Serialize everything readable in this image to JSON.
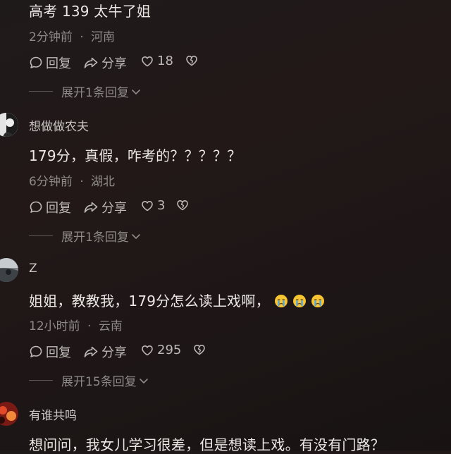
{
  "comments": [
    {
      "text": "高考 139 太牛了姐",
      "time": "2分钟前",
      "location": "河南",
      "reply_label": "回复",
      "share_label": "分享",
      "likes": "18",
      "expand_label": "展开1条回复"
    },
    {
      "username": "想做做农夫",
      "text": "179分，真假，咋考的？？？？？",
      "time": "6分钟前",
      "location": "湖北",
      "reply_label": "回复",
      "share_label": "分享",
      "likes": "3",
      "expand_label": "展开1条回复"
    },
    {
      "username": "Z",
      "text": "姐姐，教教我，179分怎么读上戏啊，",
      "emoji": "crying-face",
      "time": "12小时前",
      "location": "云南",
      "reply_label": "回复",
      "share_label": "分享",
      "likes": "295",
      "expand_label": "展开15条回复"
    },
    {
      "username": "有谁共鸣",
      "text": "想问问，我女儿学习很差，但是想读上戏。有没有门路？"
    }
  ],
  "separator": "·",
  "icons": {
    "reply": "comment-bubble-icon",
    "share": "share-arrow-icon",
    "like": "heart-icon",
    "dislike": "broken-heart-icon",
    "expand": "chevron-down-icon"
  }
}
